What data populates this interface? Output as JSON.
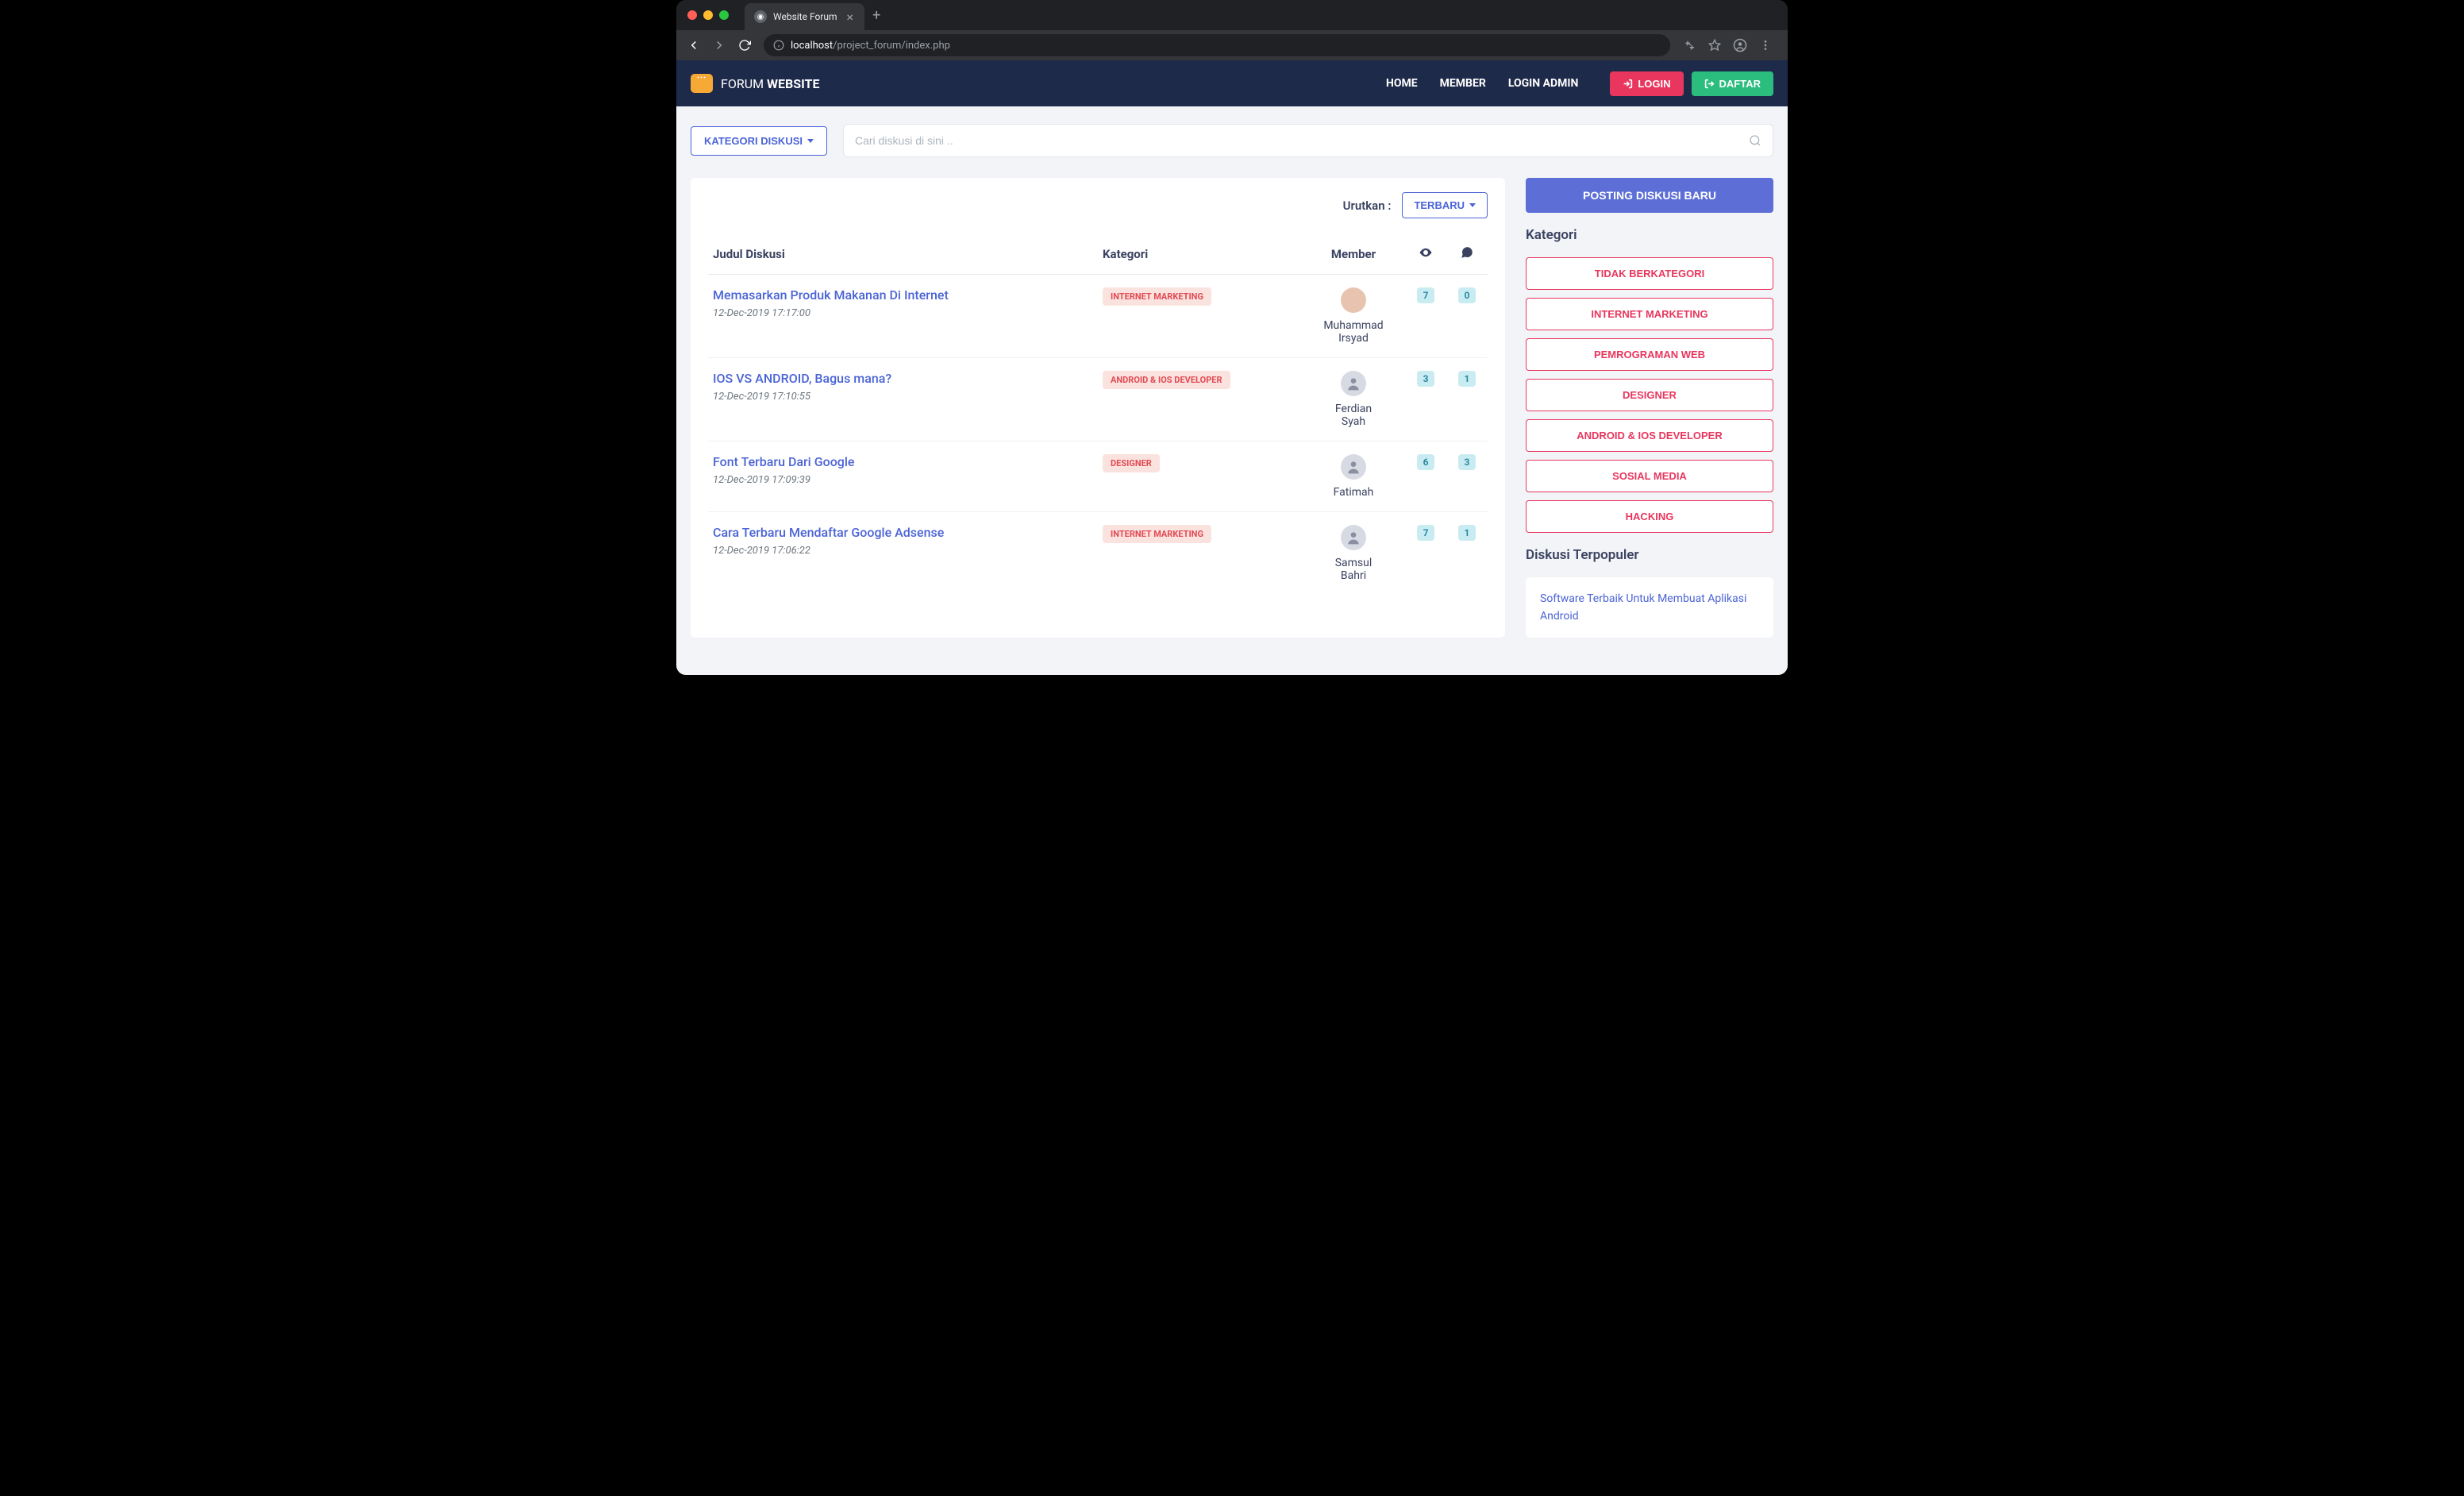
{
  "chrome": {
    "tab_title": "Website Forum",
    "url_prefix": "localhost",
    "url_path": "/project_forum/index.php"
  },
  "header": {
    "brand_thin": "FORUM ",
    "brand_bold": "WEBSITE",
    "nav": {
      "home": "HOME",
      "member": "MEMBER",
      "admin": "LOGIN ADMIN"
    },
    "login": "LOGIN",
    "register": "DAFTAR"
  },
  "toolbar": {
    "category_btn": "KATEGORI DISKUSI",
    "search_placeholder": "Cari diskusi di sini .."
  },
  "main": {
    "sort_label": "Urutkan :",
    "sort_value": "TERBARU",
    "columns": {
      "title": "Judul Diskusi",
      "category": "Kategori",
      "member": "Member"
    },
    "rows": [
      {
        "title": "Memasarkan Produk Makanan Di Internet",
        "ts": "12-Dec-2019 17:17:00",
        "category": "INTERNET MARKETING",
        "member": "Muhammad Irsyad",
        "photo": true,
        "views": "7",
        "comments": "0"
      },
      {
        "title": "IOS VS ANDROID, Bagus mana?",
        "ts": "12-Dec-2019 17:10:55",
        "category": "ANDROID & IOS DEVELOPER",
        "member": "Ferdian Syah",
        "photo": false,
        "views": "3",
        "comments": "1"
      },
      {
        "title": "Font Terbaru Dari Google",
        "ts": "12-Dec-2019 17:09:39",
        "category": "DESIGNER",
        "member": "Fatimah",
        "photo": false,
        "views": "6",
        "comments": "3"
      },
      {
        "title": "Cara Terbaru Mendaftar Google Adsense",
        "ts": "12-Dec-2019 17:06:22",
        "category": "INTERNET MARKETING",
        "member": "Samsul Bahri",
        "photo": false,
        "views": "7",
        "comments": "1"
      }
    ]
  },
  "sidebar": {
    "post_btn": "POSTING DISKUSI BARU",
    "cat_heading": "Kategori",
    "categories": [
      "TIDAK BERKATEGORI",
      "INTERNET MARKETING",
      "PEMROGRAMAN WEB",
      "DESIGNER",
      "ANDROID & IOS DEVELOPER",
      "SOSIAL MEDIA",
      "HACKING"
    ],
    "pop_heading": "Diskusi Terpopuler",
    "pop_item": "Software Terbaik Untuk Membuat Aplikasi Android"
  }
}
